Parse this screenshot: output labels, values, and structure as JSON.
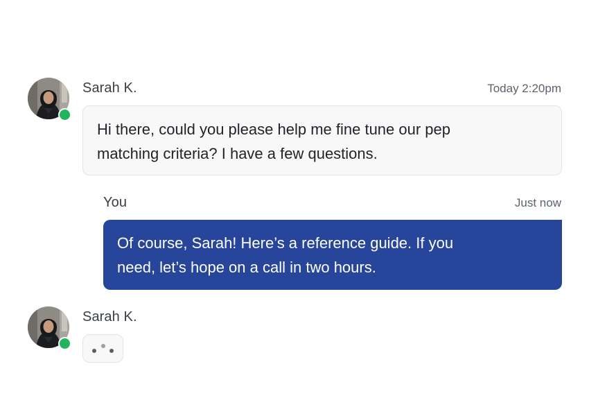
{
  "messages": [
    {
      "sender": "Sarah K.",
      "time": "Today 2:20pm",
      "text": "Hi there, could you please help me fine tune our pep\nmatching criteria? I have a few questions."
    },
    {
      "sender": "You",
      "time": "Just now",
      "text": "Of course, Sarah! Here’s a reference guide. If you\nneed, let’s hope on a call in two hours."
    }
  ],
  "typing": {
    "sender": "Sarah K."
  },
  "colors": {
    "outgoing_bubble": "#27469b",
    "incoming_bubble": "#f8f8f9",
    "presence_online": "#22b35e"
  },
  "icons": {
    "presence": "online-status-dot",
    "typing": "typing-dots-icon"
  }
}
